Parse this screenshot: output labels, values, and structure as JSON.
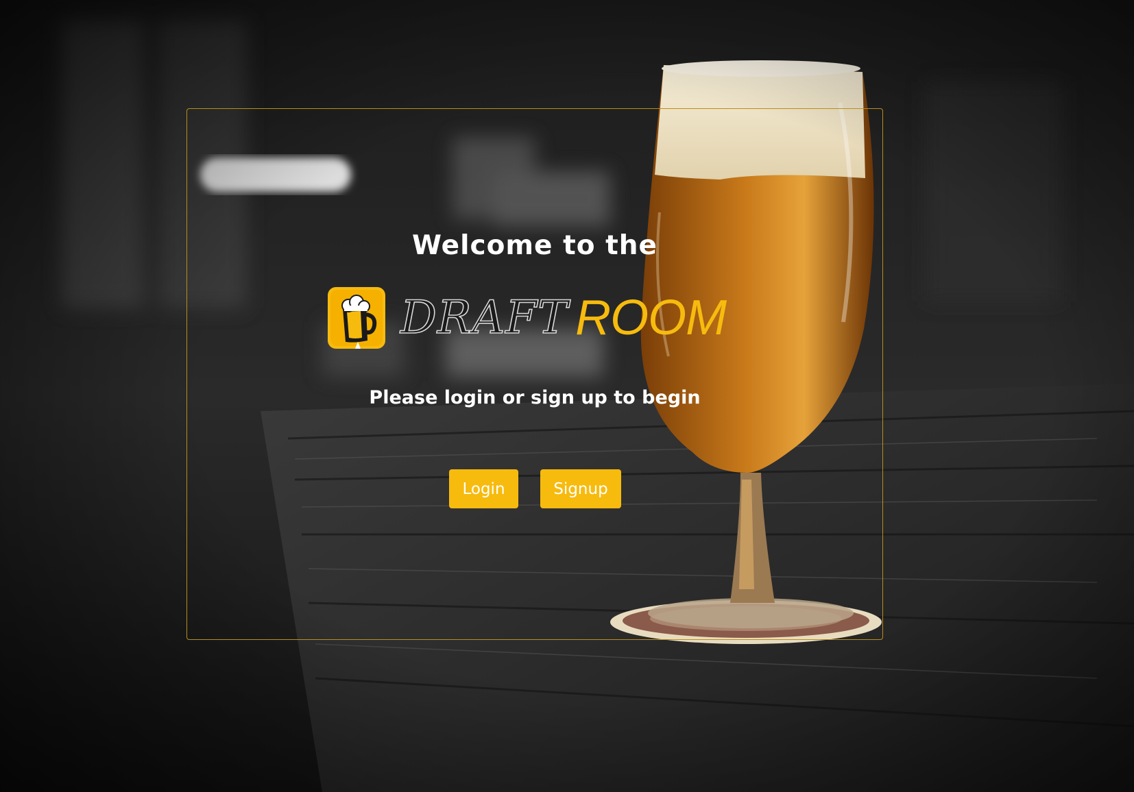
{
  "welcome_title": "Welcome to the",
  "logo": {
    "word_draft": "DRAFT",
    "word_room": "ROOM",
    "icon": "beer-mug-icon"
  },
  "subtitle": "Please login or sign up to begin",
  "buttons": {
    "login_label": "Login",
    "signup_label": "Signup"
  },
  "colors": {
    "accent": "#f7bb0e",
    "card_border": "#b88e1c",
    "text": "#ffffff"
  }
}
